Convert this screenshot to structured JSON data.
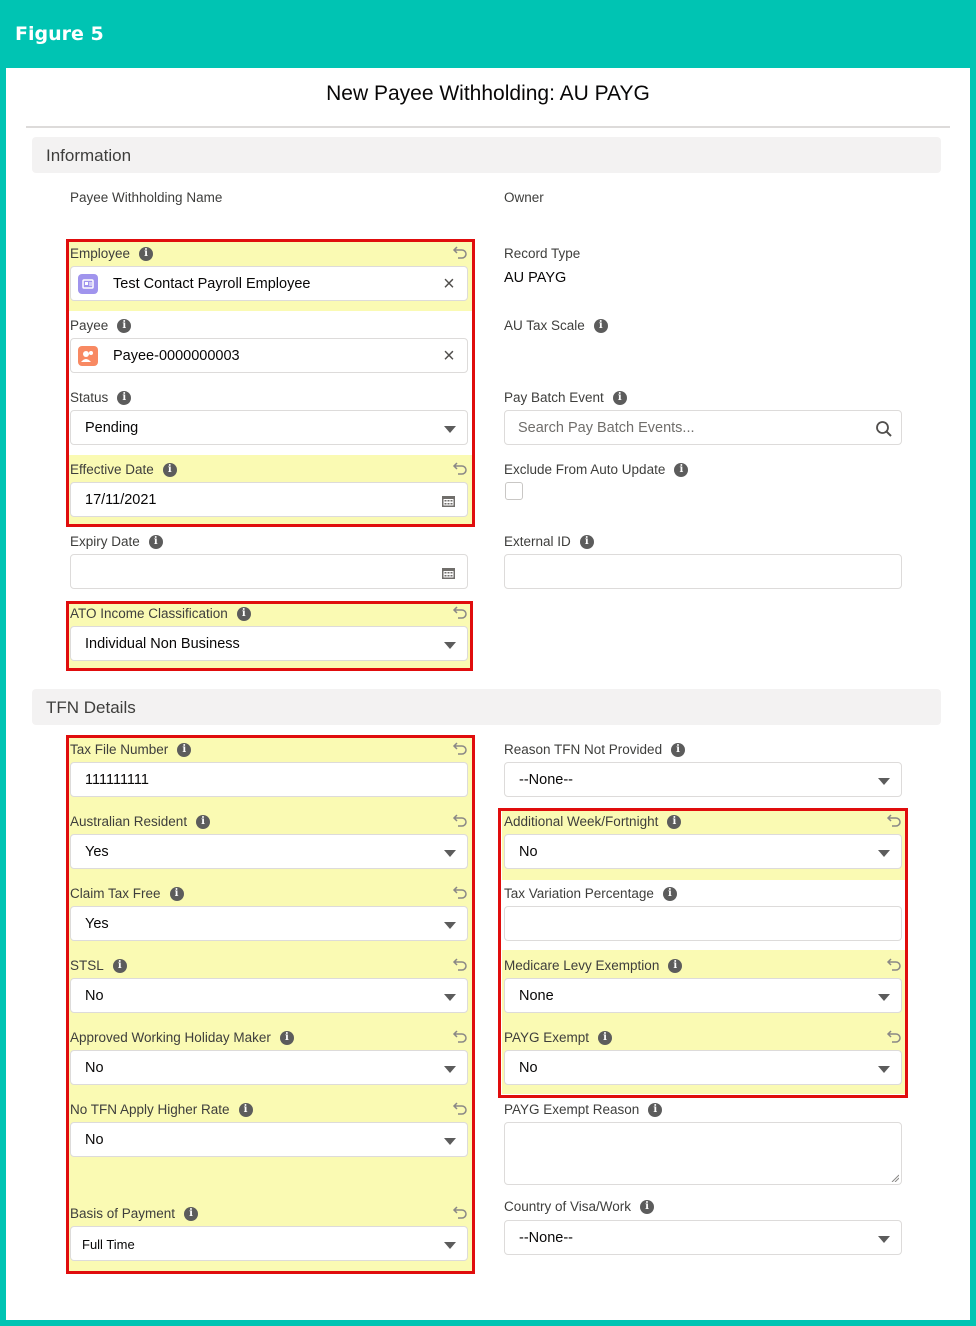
{
  "figure": {
    "title": "Figure 5"
  },
  "modal": {
    "title": "New Payee Withholding: AU PAYG"
  },
  "colors": {
    "frame": "#00c4b3",
    "highlight": "#fafab3",
    "outline": "#e00d0d"
  },
  "sections": {
    "information": "Information",
    "tfn": "TFN Details"
  },
  "info": {
    "payee_withholding_name": "Payee Withholding Name",
    "owner": "Owner",
    "employee": {
      "label": "Employee",
      "value": "Test Contact Payroll Employee"
    },
    "record_type": {
      "label": "Record Type",
      "value": "AU PAYG"
    },
    "payee": {
      "label": "Payee",
      "value": "Payee-0000000003"
    },
    "au_tax_scale": {
      "label": "AU Tax Scale"
    },
    "status": {
      "label": "Status",
      "value": "Pending"
    },
    "pay_batch_event": {
      "label": "Pay Batch Event",
      "placeholder": "Search Pay Batch Events..."
    },
    "effective_date": {
      "label": "Effective Date",
      "value": "17/11/2021"
    },
    "exclude_auto_update": {
      "label": "Exclude From Auto Update",
      "checked": false
    },
    "expiry_date": {
      "label": "Expiry Date",
      "value": ""
    },
    "external_id": {
      "label": "External ID",
      "value": ""
    },
    "ato_income_classification": {
      "label": "ATO Income Classification",
      "value": "Individual Non Business"
    }
  },
  "tfn": {
    "tax_file_number": {
      "label": "Tax File Number",
      "value": "111111111"
    },
    "reason_tfn_not_provided": {
      "label": "Reason TFN Not Provided",
      "value": "--None--"
    },
    "australian_resident": {
      "label": "Australian Resident",
      "value": "Yes"
    },
    "additional_week": {
      "label": "Additional Week/Fortnight",
      "value": "No"
    },
    "claim_tax_free": {
      "label": "Claim Tax Free",
      "value": "Yes"
    },
    "tax_variation_percentage": {
      "label": "Tax Variation Percentage",
      "value": ""
    },
    "stsl": {
      "label": "STSL",
      "value": "No"
    },
    "medicare_levy_exemption": {
      "label": "Medicare Levy Exemption",
      "value": "None"
    },
    "approved_whm": {
      "label": "Approved Working Holiday Maker",
      "value": "No"
    },
    "payg_exempt": {
      "label": "PAYG Exempt",
      "value": "No"
    },
    "no_tfn_higher_rate": {
      "label": "No TFN Apply Higher Rate",
      "value": "No"
    },
    "payg_exempt_reason": {
      "label": "PAYG Exempt Reason",
      "value": ""
    },
    "country_of_visa": {
      "label": "Country of Visa/Work",
      "value": "--None--"
    },
    "basis_of_payment": {
      "label": "Basis of Payment",
      "value": "Full Time"
    }
  }
}
